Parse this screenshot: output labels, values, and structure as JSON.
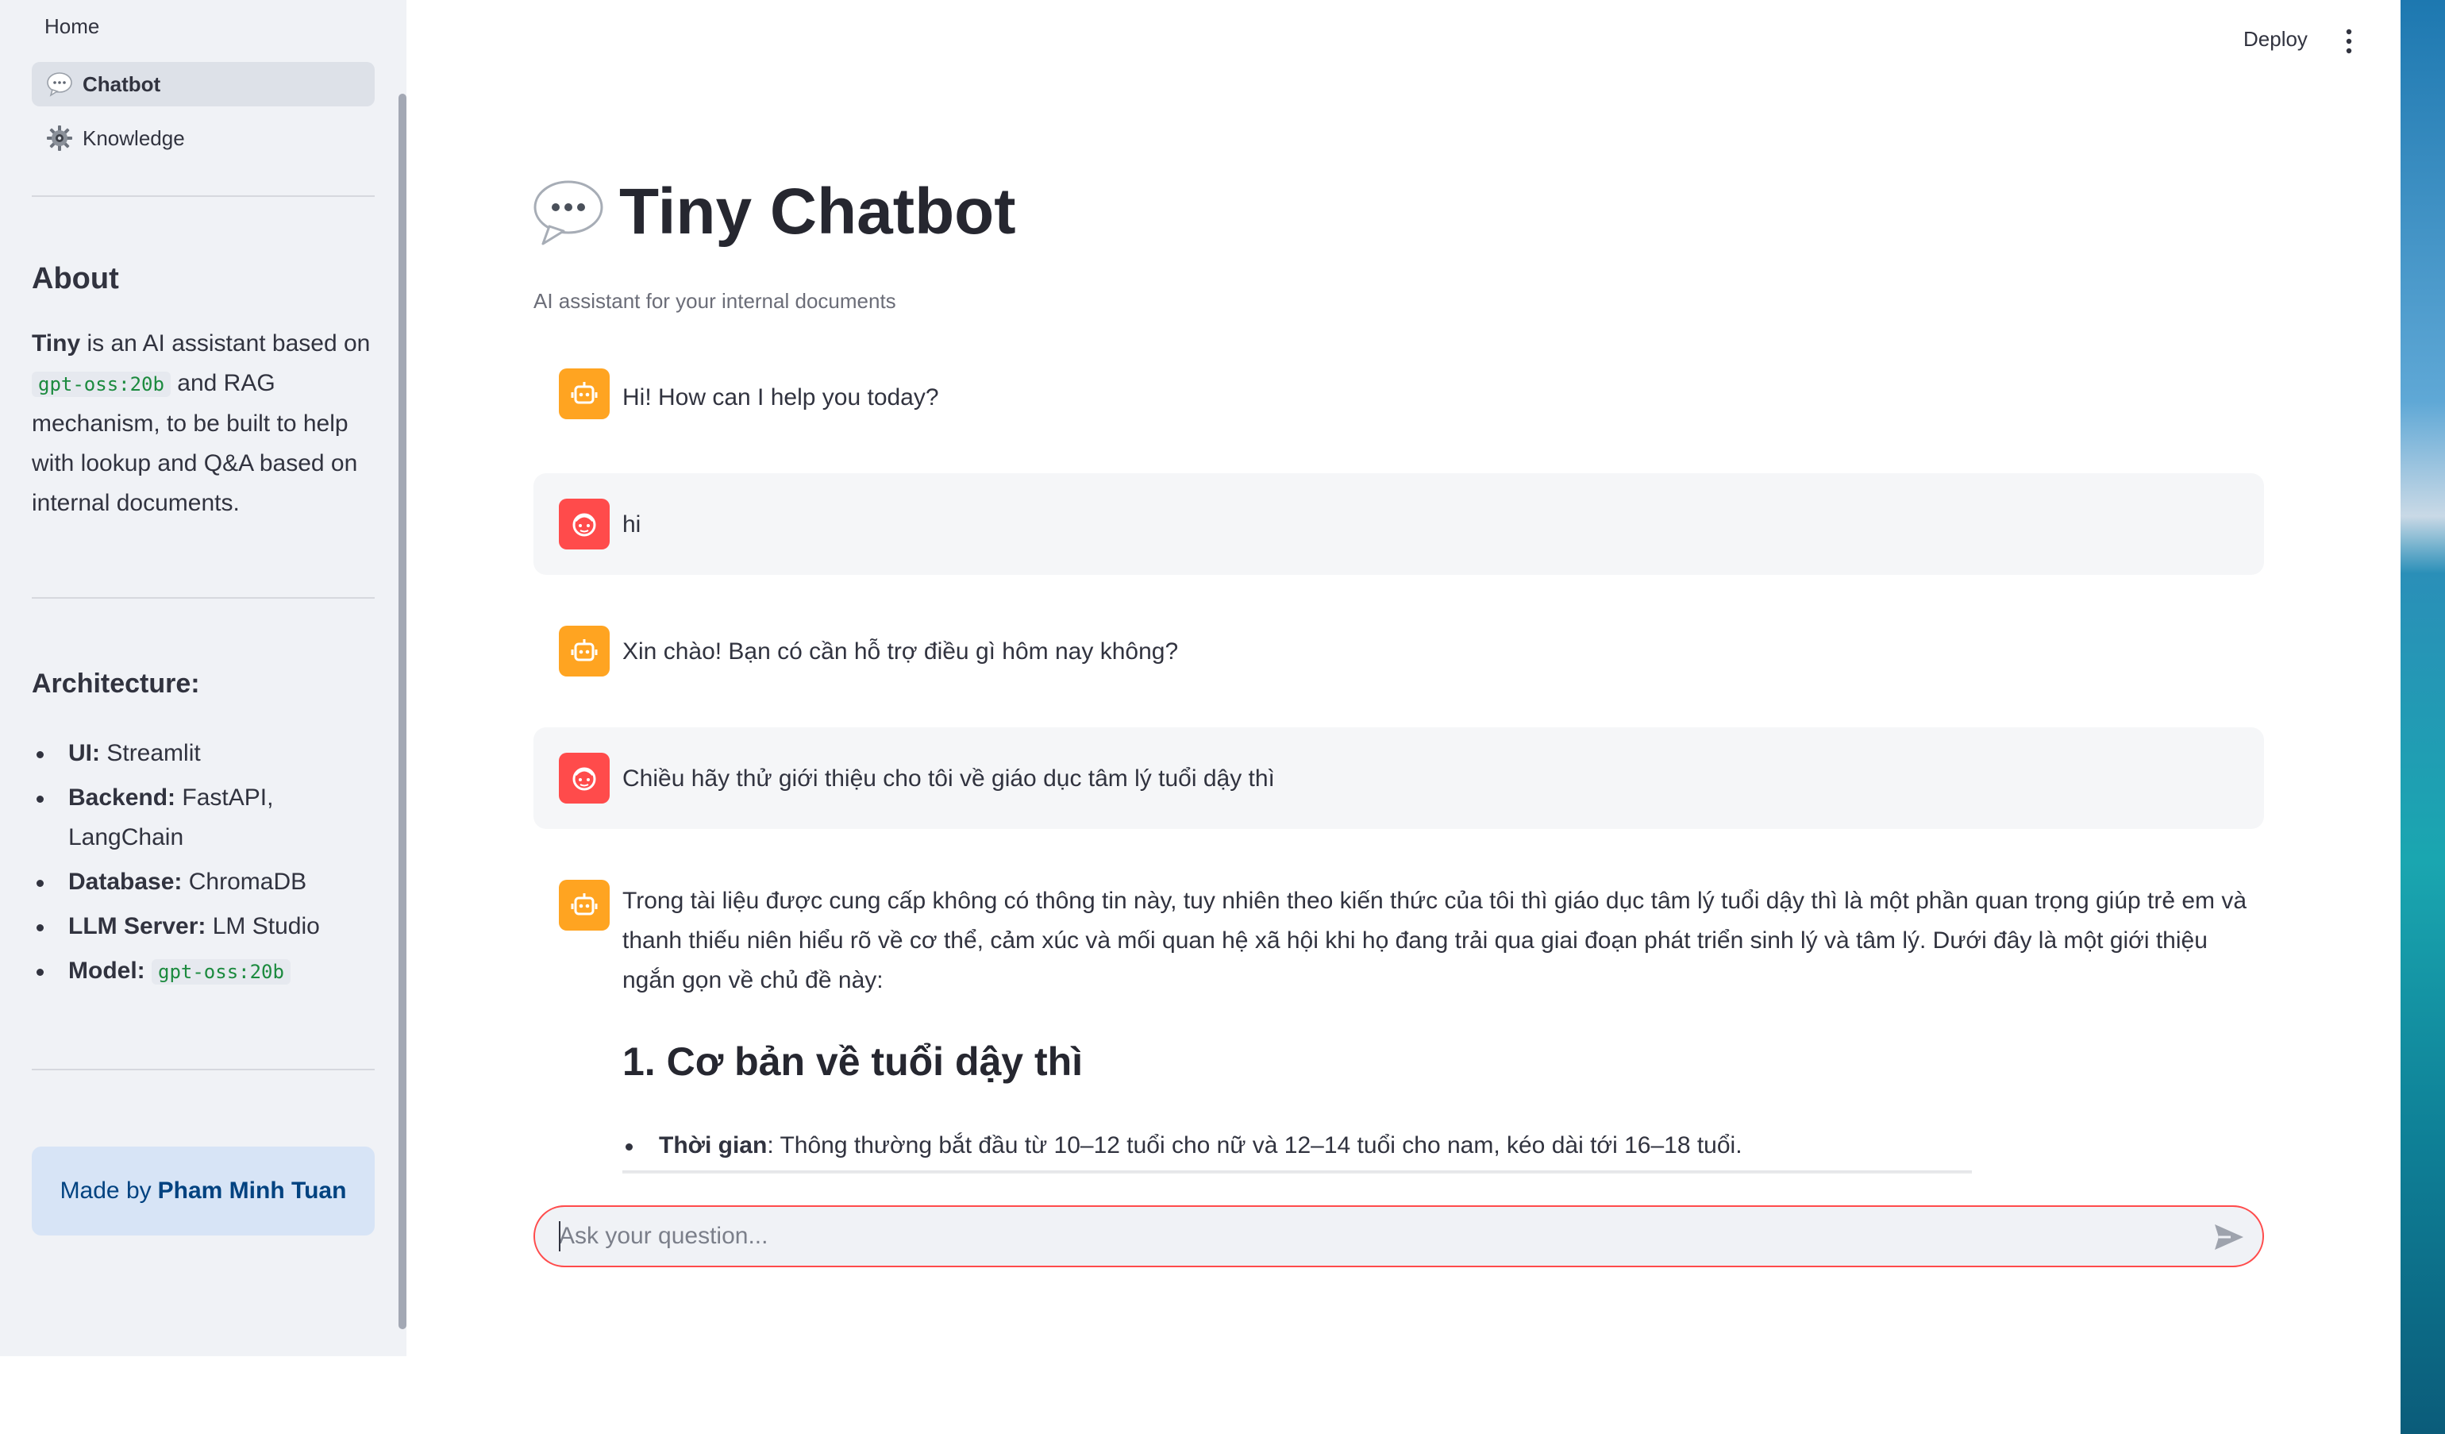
{
  "sidebar": {
    "nav": {
      "home": "Home",
      "items": [
        {
          "label": "Chatbot",
          "icon": "speech-balloon-icon",
          "active": true
        },
        {
          "label": "Knowledge",
          "icon": "gear-icon",
          "active": false
        }
      ]
    },
    "about": {
      "title": "About",
      "name": "Tiny",
      "text_1": " is an AI assistant based on ",
      "model": "gpt-oss:20b",
      "text_2": " and RAG mechanism, to be built to help with lookup and Q&A based on internal documents."
    },
    "architecture": {
      "title": "Architecture:",
      "items": [
        {
          "key": "UI:",
          "value": "Streamlit"
        },
        {
          "key": "Backend:",
          "value": "FastAPI, LangChain"
        },
        {
          "key": "Database:",
          "value": "ChromaDB"
        },
        {
          "key": "LLM Server:",
          "value": "LM Studio"
        },
        {
          "key": "Model:",
          "value": "gpt-oss:20b"
        }
      ]
    },
    "made_by": {
      "prefix": "Made by",
      "author": "Pham Minh Tuan"
    }
  },
  "header": {
    "deploy_label": "Deploy",
    "menu_icon": "more-vertical-icon"
  },
  "main": {
    "title": "Tiny Chatbot",
    "title_icon": "speech-balloon-icon",
    "subtitle": "AI assistant for your internal documents",
    "messages": [
      {
        "role": "assistant",
        "text": "Hi! How can I help you today?"
      },
      {
        "role": "user",
        "text": "hi"
      },
      {
        "role": "assistant",
        "text": "Xin chào! Bạn có cần hỗ trợ điều gì hôm nay không?"
      },
      {
        "role": "user",
        "text": "Chiều hãy thử giới thiệu cho tôi về giáo dục tâm lý tuổi dậy thì"
      },
      {
        "role": "assistant",
        "text": "Trong tài liệu được cung cấp không có thông tin này, tuy nhiên theo kiến thức của tôi thì giáo dục tâm lý tuổi dậy thì là một phần quan trọng giúp trẻ em và thanh thiếu niên hiểu rõ về cơ thể, cảm xúc và mối quan hệ xã hội khi họ đang trải qua giai đoạn phát triển sinh lý và tâm lý. Dưới đây là một giới thiệu ngắn gọn về chủ đề này:"
      }
    ],
    "answer_heading": "1. Cơ bản về tuổi dậy thì",
    "answer_bullet": {
      "key": "Thời gian",
      "value": ": Thông thường bắt đầu từ 10–12 tuổi cho nữ và 12–14 tuổi cho nam, kéo dài tới 16–18 tuổi."
    }
  },
  "chat_input": {
    "placeholder": "Ask your question...",
    "value": ""
  },
  "colors": {
    "accent": "#ff4b4b",
    "bot_avatar": "#ffa421",
    "user_avatar": "#ff4b4b",
    "sidebar_bg": "#f0f2f6",
    "made_by_bg": "#d7e4f6",
    "code_green": "#1b8a3e"
  }
}
